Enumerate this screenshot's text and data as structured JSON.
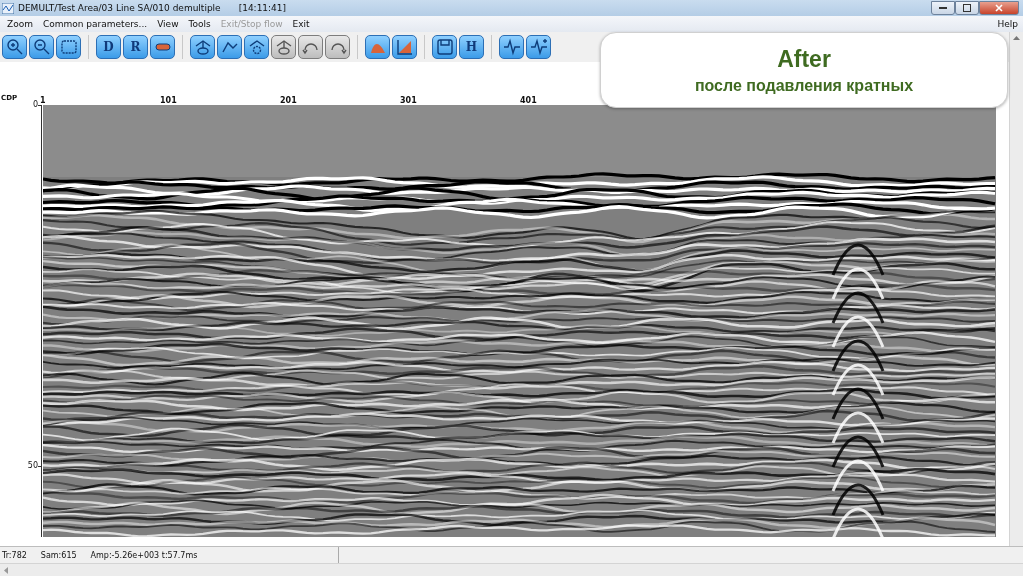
{
  "window": {
    "title": "DEMULT/Test Area/03 Line SA/010 demultiple",
    "time": "[14:11:41]"
  },
  "menu": [
    {
      "label": "Zoom",
      "disabled": false
    },
    {
      "label": "Common parameters...",
      "disabled": false
    },
    {
      "label": "View",
      "disabled": false
    },
    {
      "label": "Tools",
      "disabled": false
    },
    {
      "label": "Exit/Stop flow",
      "disabled": true
    },
    {
      "label": "Exit",
      "disabled": false
    }
  ],
  "help_menu": "Help",
  "toolbar": [
    [
      {
        "kind": "zoom-in",
        "disabled": false
      },
      {
        "kind": "zoom-out",
        "disabled": false
      },
      {
        "kind": "frame",
        "disabled": false
      }
    ],
    [
      {
        "kind": "letter",
        "label": "D",
        "disabled": false
      },
      {
        "kind": "letter",
        "label": "R",
        "disabled": false
      },
      {
        "kind": "bar",
        "disabled": false
      }
    ],
    [
      {
        "kind": "db-up",
        "disabled": false
      },
      {
        "kind": "polyline",
        "disabled": false
      },
      {
        "kind": "gear-house",
        "disabled": false
      },
      {
        "kind": "db-down",
        "disabled": true
      },
      {
        "kind": "undo",
        "disabled": true
      },
      {
        "kind": "redo",
        "disabled": true
      }
    ],
    [
      {
        "kind": "hill",
        "disabled": false
      },
      {
        "kind": "ramp",
        "disabled": false
      }
    ],
    [
      {
        "kind": "save",
        "disabled": false
      },
      {
        "kind": "letter",
        "label": "H",
        "disabled": false
      }
    ],
    [
      {
        "kind": "wave",
        "disabled": false
      },
      {
        "kind": "wave-plus",
        "disabled": false
      }
    ]
  ],
  "overlay": {
    "title": "After",
    "subtitle": "после подавления кратных"
  },
  "plot": {
    "x_axis_title": "CDP",
    "x_labels": [
      "1",
      "101",
      "201",
      "301",
      "401"
    ],
    "y_labels": [
      "0",
      "50"
    ]
  },
  "status_bar": [
    "Tr:782",
    "Sam:615",
    "Amp:-5.26e+003 t:57.7ms"
  ]
}
